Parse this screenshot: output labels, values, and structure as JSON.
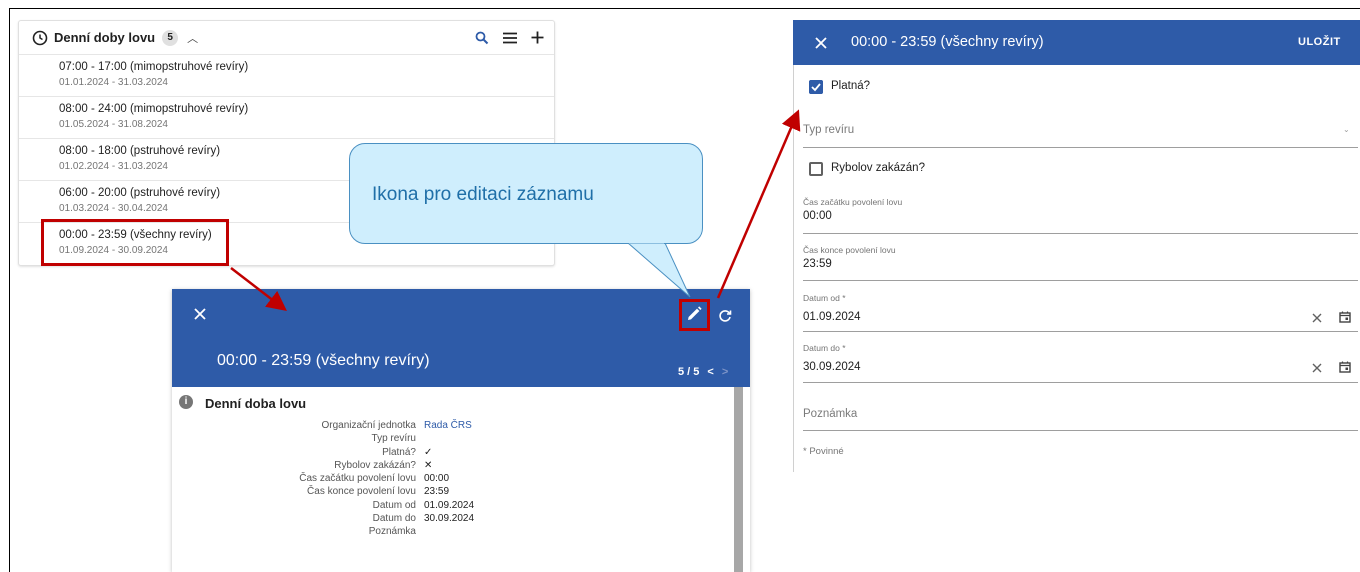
{
  "list": {
    "title": "Denní doby lovu",
    "count": "5",
    "items": [
      {
        "time": "07:00 - 17:00 (mimopstruhové revíry)",
        "dates": "01.01.2024 - 31.03.2024"
      },
      {
        "time": "08:00 - 24:00 (mimopstruhové revíry)",
        "dates": "01.05.2024 - 31.08.2024"
      },
      {
        "time": "08:00 - 18:00 (pstruhové revíry)",
        "dates": "01.02.2024 - 31.03.2024"
      },
      {
        "time": "06:00 - 20:00 (pstruhové revíry)",
        "dates": "01.03.2024 - 30.04.2024"
      },
      {
        "time": "00:00 - 23:59 (všechny revíry)",
        "dates": "01.09.2024 - 30.09.2024"
      }
    ]
  },
  "callout": {
    "text": "Ikona pro editaci záznamu"
  },
  "detail": {
    "title": "00:00 - 23:59 (všechny revíry)",
    "pager": "5 / 5",
    "section": "Denní doba lovu",
    "fields": [
      {
        "label": "Organizační jednotka",
        "value": "Rada ČRS"
      },
      {
        "label": "Typ revíru",
        "value": ""
      },
      {
        "label": "Platná?",
        "value": "✓"
      },
      {
        "label": "Rybolov zakázán?",
        "value": "✕"
      },
      {
        "label": "Čas začátku povolení lovu",
        "value": "00:00"
      },
      {
        "label": "Čas konce povolení lovu",
        "value": "23:59"
      },
      {
        "label": "Datum od",
        "value": "01.09.2024"
      },
      {
        "label": "Datum do",
        "value": "30.09.2024"
      },
      {
        "label": "Poznámka",
        "value": ""
      }
    ]
  },
  "form": {
    "title": "00:00 - 23:59 (všechny revíry)",
    "save": "ULOŽIT",
    "valid_label": "Platná?",
    "type_placeholder": "Typ revíru",
    "banned_label": "Rybolov zakázán?",
    "start_label": "Čas začátku povolení lovu",
    "start_value": "00:00",
    "end_label": "Čas konce povolení lovu",
    "end_value": "23:59",
    "from_label": "Datum od *",
    "from_value": "01.09.2024",
    "to_label": "Datum do *",
    "to_value": "30.09.2024",
    "note_placeholder": "Poznámka",
    "required_note": "* Povinné"
  },
  "colors": {
    "primary": "#2e5ba8",
    "highlight": "#c00000",
    "callout_fill": "#cfeefd"
  }
}
